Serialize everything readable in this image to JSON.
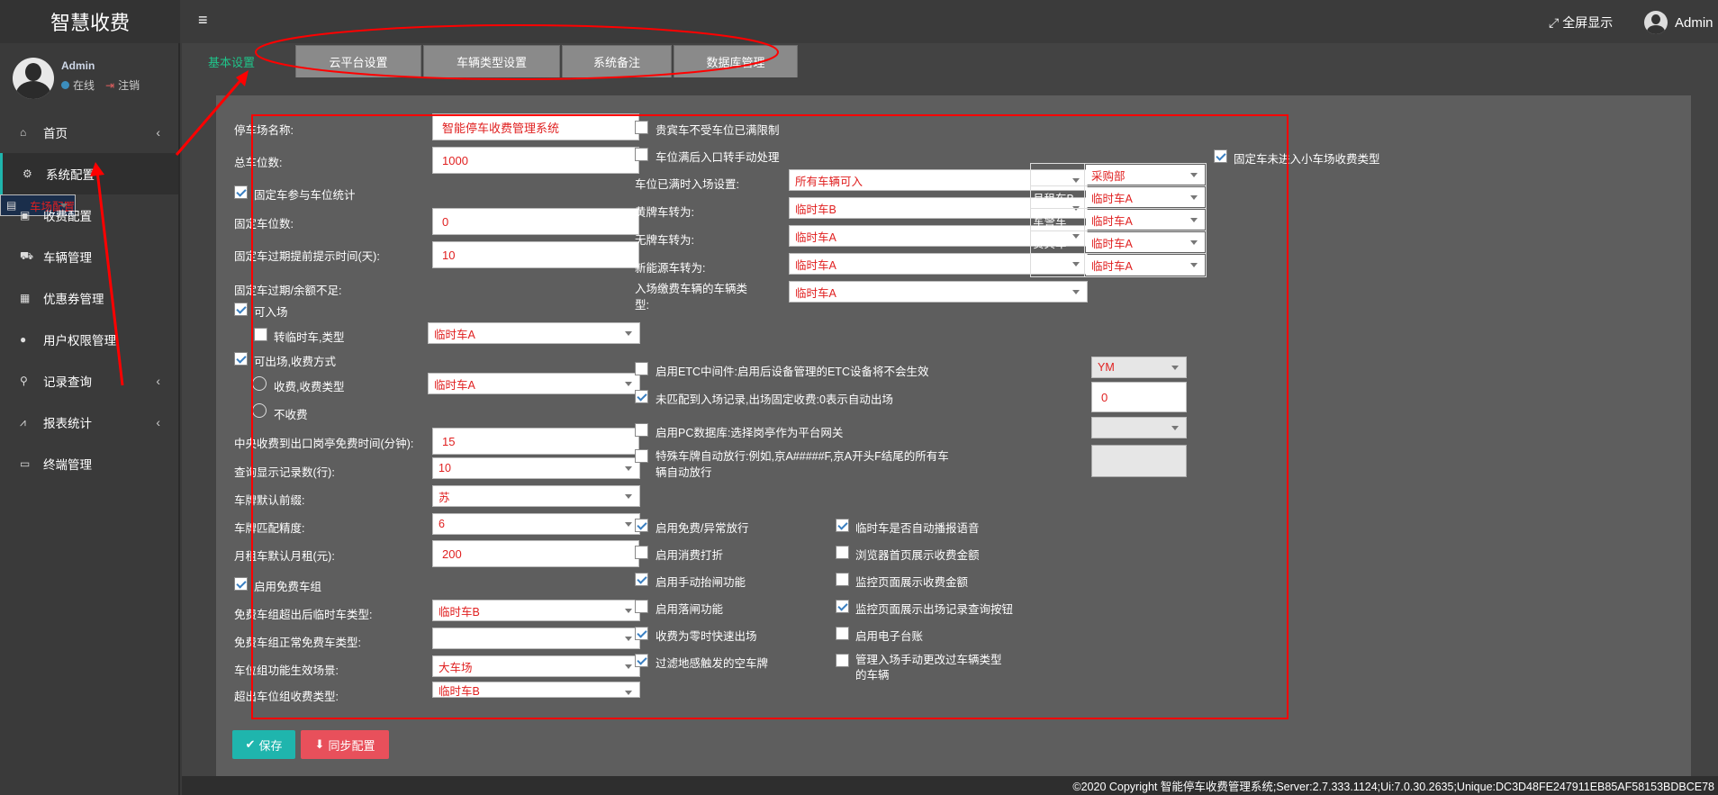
{
  "app": {
    "title": "智慧收费",
    "menu_icon": "hamburger-icon",
    "fullscreen": "全屏显示",
    "user": "Admin"
  },
  "sidebar": {
    "user_name": "Admin",
    "status": "在线",
    "logout": "注销",
    "items": [
      {
        "label": "首页",
        "icon": "home-icon",
        "chevron": "‹"
      },
      {
        "label": "系统配置",
        "icon": "cogs-icon"
      },
      {
        "label": "车场配置",
        "icon": "file-icon"
      },
      {
        "label": "收费配置",
        "icon": "money-icon"
      },
      {
        "label": "车辆管理",
        "icon": "car-icon"
      },
      {
        "label": "优惠券管理",
        "icon": "calendar-icon"
      },
      {
        "label": "用户权限管理",
        "icon": "user-icon"
      },
      {
        "label": "记录查询",
        "icon": "search-icon",
        "chevron": "‹"
      },
      {
        "label": "报表统计",
        "icon": "chart-icon",
        "chevron": "‹"
      },
      {
        "label": "终端管理",
        "icon": "monitor-icon"
      }
    ]
  },
  "tabs": [
    "基本设置",
    "云平台设置",
    "车辆类型设置",
    "系统备注",
    "数据库管理"
  ],
  "left": {
    "park_name_label": "停车场名称:",
    "park_name": "智能停车收费管理系统",
    "total_label": "总车位数:",
    "total": "1000",
    "fixed_stat": "固定车参与车位统计",
    "fixed_count_label": "固定车位数:",
    "fixed_count": "0",
    "expire_days_label": "固定车过期提前提示时间(天):",
    "expire_days": "10",
    "expire_label": "固定车过期/余额不足:",
    "can_enter": "可入场",
    "to_temp_label": "转临时车,类型",
    "to_temp": "临时车A",
    "can_exit": "可出场,收费方式",
    "charge_label": "收费,收费类型",
    "charge": "临时车A",
    "no_charge": "不收费",
    "free_minutes_label": "中央收费到出口岗亭免费时间(分钟):",
    "free_minutes": "15",
    "records_label": "查询显示记录数(行):",
    "records": "10",
    "prefix_label": "车牌默认前缀:",
    "prefix": "苏",
    "precision_label": "车牌匹配精度:",
    "precision": "6",
    "monthly_label": "月租车默认月租(元):",
    "monthly": "200",
    "free_group": "启用免费车组",
    "free_over_label": "免费车组超出后临时车类型:",
    "free_over": "临时车B",
    "free_normal_label": "免费车组正常免费车类型:",
    "free_normal": "",
    "group_scene_label": "车位组功能生效场景:",
    "group_scene": "大车场",
    "over_group_label": "超出车位组收费类型:",
    "over_group": "临时车B"
  },
  "mid": {
    "vip_unlimited": "贵宾车不受车位已满限制",
    "full_manual": "车位满后入口转手动处理",
    "full_setting_label": "车位已满时入场设置:",
    "full_setting": "所有车辆可入",
    "yellow_label": "黄牌车转为:",
    "yellow": "临时车B",
    "noplate_label": "无牌车转为:",
    "noplate": "临时车A",
    "newenergy_label": "新能源车转为:",
    "newenergy": "临时车A",
    "entry_pay_label": "入场缴费车辆的车辆类型:",
    "entry_pay": "临时车A",
    "etc_label": "启用ETC中间件:启用后设备管理的ETC设备将不会生效",
    "etc": "YM",
    "nomatch_label": "未匹配到入场记录,出场固定收费:0表示自动出场",
    "nomatch": "0",
    "pcdb_label": "启用PC数据库:选择岗亭作为平台网关",
    "pcdb": "",
    "special_label": "特殊车牌自动放行:例如,京A#####F,京A开头F结尾的所有车辆自动放行"
  },
  "checks_left": [
    {
      "label": "启用免费/异常放行",
      "on": true
    },
    {
      "label": "启用消费打折",
      "on": false
    },
    {
      "label": "启用手动抬闸功能",
      "on": true
    },
    {
      "label": "启用落闸功能",
      "on": false
    },
    {
      "label": "收费为零时快速出场",
      "on": true
    },
    {
      "label": "过滤地感触发的空车牌",
      "on": true
    }
  ],
  "checks_right": [
    {
      "label": "临时车是否自动播报语音",
      "on": true
    },
    {
      "label": "浏览器首页展示收费金额",
      "on": false
    },
    {
      "label": "监控页面展示收费金额",
      "on": false
    },
    {
      "label": "监控页面展示出场记录查询按钮",
      "on": true
    },
    {
      "label": "启用电子台账",
      "on": false
    },
    {
      "label": "管理入场手动更改过车辆类型的车辆",
      "on": false
    }
  ],
  "right": {
    "title": "固定车未进入小车场收费类型",
    "rows": [
      {
        "name": "采购部",
        "value": "采购部"
      },
      {
        "name": "月租车B",
        "value": "临时车A"
      },
      {
        "name": "军警车",
        "value": "临时车A"
      },
      {
        "name": "贵宾车",
        "value": "临时车A"
      },
      {
        "name": "储值车A",
        "value": "临时车A"
      }
    ]
  },
  "buttons": {
    "save": "保存",
    "sync": "同步配置"
  },
  "footer": "©2020 Copyright  智能停车收费管理系统;Server:2.7.333.1124;Ui:7.0.30.2635;Unique:DC3D48FE247911EB85AF58153BDBCE78",
  "colors": {
    "accent": "#1fc48a",
    "value_red": "#e02020",
    "save": "#1fb5ad",
    "sync": "#e8505b",
    "annotation": "#ff0000"
  }
}
